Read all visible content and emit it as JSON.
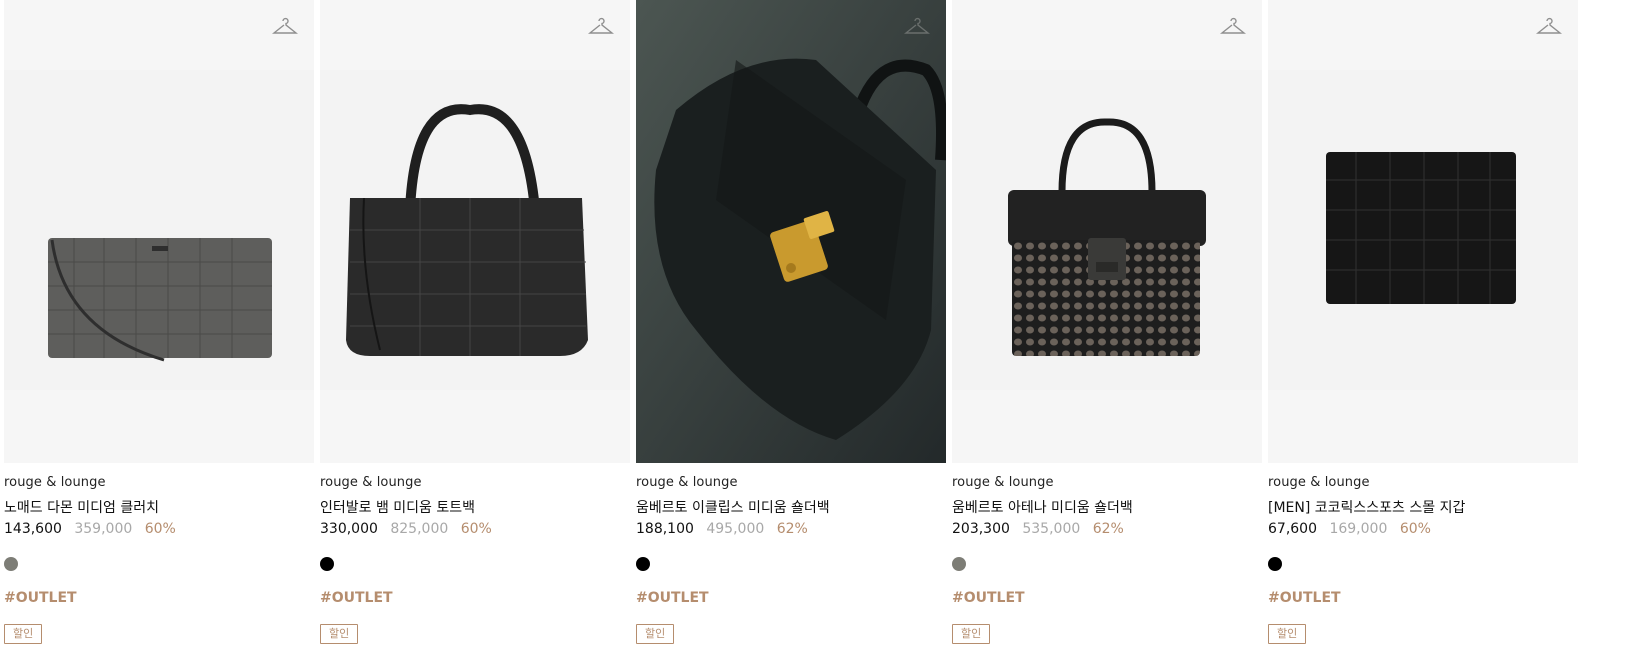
{
  "products": [
    {
      "brand": "rouge & lounge",
      "name": "노매드 다몬 미디엄 클러치",
      "price": "143,600",
      "original_price": "359,000",
      "discount": "60%",
      "swatch_color": "#7d7d76",
      "tag": "#OUTLET",
      "badge": "할인",
      "image_type": "grey-croc-clutch"
    },
    {
      "brand": "rouge & lounge",
      "name": "인터발로 뱀 미디움 토트백",
      "price": "330,000",
      "original_price": "825,000",
      "discount": "60%",
      "swatch_color": "#000000",
      "tag": "#OUTLET",
      "badge": "할인",
      "image_type": "black-python-tote"
    },
    {
      "brand": "rouge & lounge",
      "name": "움베르토 이클립스 미디움 숄더백",
      "price": "188,100",
      "original_price": "495,000",
      "discount": "62%",
      "swatch_color": "#000000",
      "tag": "#OUTLET",
      "badge": "할인",
      "image_type": "black-shoulder-bag-gold-clasp"
    },
    {
      "brand": "rouge & lounge",
      "name": "움베르토 아테나 미디움 숄더백",
      "price": "203,300",
      "original_price": "535,000",
      "discount": "62%",
      "swatch_color": "#7d7d76",
      "tag": "#OUTLET",
      "badge": "할인",
      "image_type": "black-mesh-top-handle-bag"
    },
    {
      "brand": "rouge & lounge",
      "name": "[MEN] 코코릭스스포츠 스몰 지갑",
      "price": "67,600",
      "original_price": "169,000",
      "discount": "60%",
      "swatch_color": "#000000",
      "tag": "#OUTLET",
      "badge": "할인",
      "image_type": "black-croc-wallet"
    }
  ],
  "icons": {
    "wishlist": "hanger-icon"
  }
}
